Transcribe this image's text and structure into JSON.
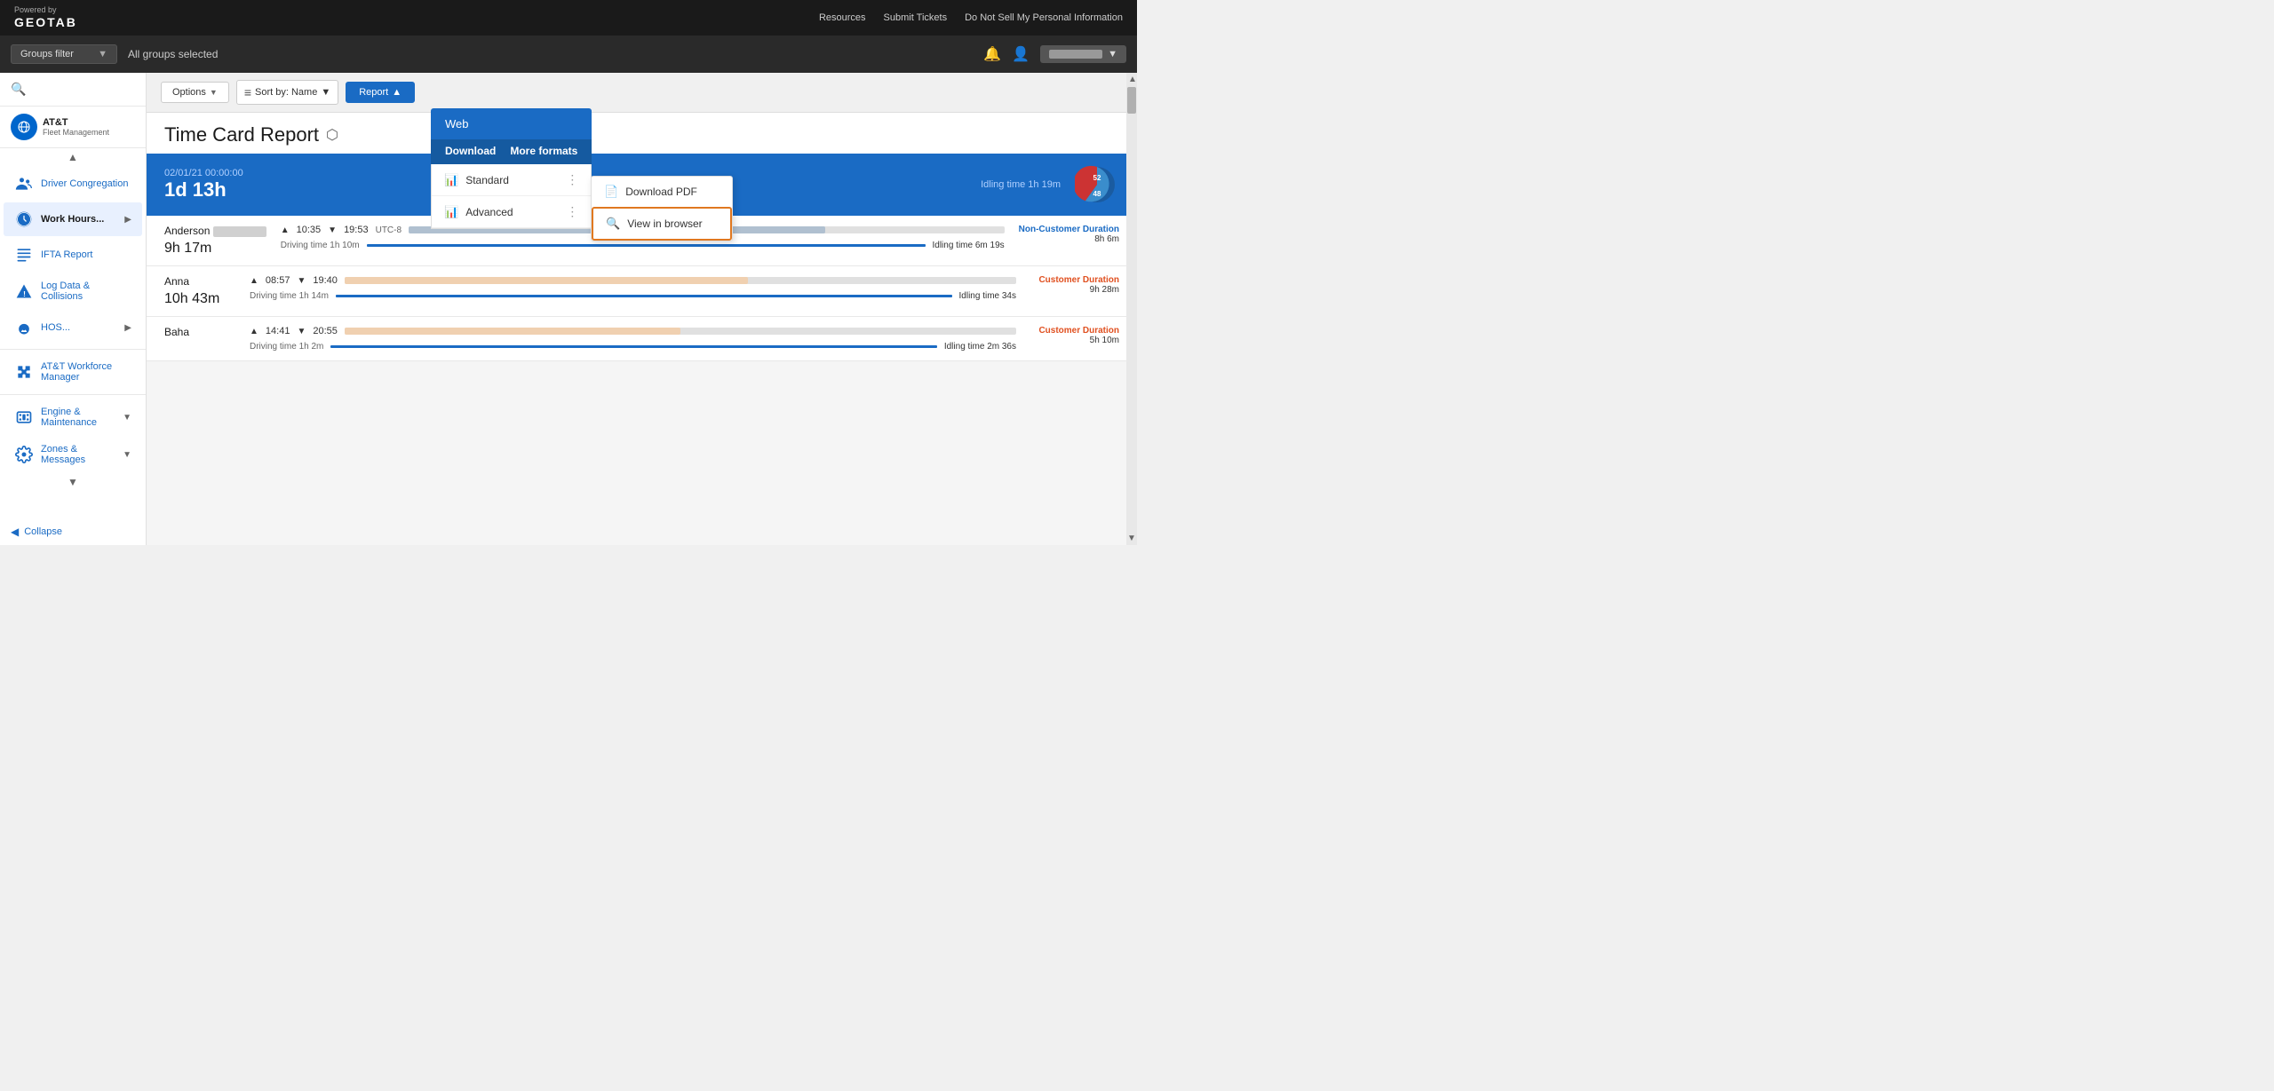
{
  "topnav": {
    "powered_by": "Powered by",
    "brand": "GEOTAB",
    "resources": "Resources",
    "submit_tickets": "Submit Tickets",
    "do_not_sell": "Do Not Sell My Personal Information"
  },
  "header": {
    "groups_filter_label": "Groups filter",
    "groups_filter_arrow": "▼",
    "all_groups_selected": "All groups selected",
    "bell_icon": "🔔",
    "user_icon": "👤",
    "user_name": ""
  },
  "sidebar": {
    "brand_name": "AT&T",
    "brand_sub": "Fleet Management",
    "items": [
      {
        "id": "driver-congregation",
        "label": "Driver Congregation",
        "icon": "people",
        "has_arrow": false
      },
      {
        "id": "work-hours",
        "label": "Work Hours...",
        "icon": "clock",
        "has_arrow": true
      },
      {
        "id": "ifta-report",
        "label": "IFTA Report",
        "icon": "list",
        "has_arrow": false
      },
      {
        "id": "log-data",
        "label": "Log Data & Collisions",
        "icon": "warning",
        "has_arrow": false
      },
      {
        "id": "hos",
        "label": "HOS...",
        "icon": "gauge",
        "has_arrow": true
      }
    ],
    "section2": [
      {
        "id": "att-workforce",
        "label": "AT&T Workforce Manager",
        "icon": "puzzle",
        "has_arrow": false
      }
    ],
    "section3": [
      {
        "id": "engine-maintenance",
        "label": "Engine & Maintenance",
        "icon": "film",
        "has_arrow": true
      },
      {
        "id": "zones-messages",
        "label": "Zones & Messages",
        "icon": "gear",
        "has_arrow": true
      }
    ],
    "collapse_label": "Collapse",
    "scroll_up": "▲",
    "scroll_down": "▼"
  },
  "toolbar": {
    "options_label": "Options",
    "sort_icon": "≡",
    "sort_label": "Sort by:  Name",
    "sort_arrow": "▼",
    "report_label": "Report",
    "report_arrow": "▲"
  },
  "report": {
    "title": "Time Card Report",
    "title_icon": "⬡",
    "summary_date": "02/01/21 00:00:00",
    "summary_total": "1d 13h",
    "idling_label": "Idling time 1h 19m",
    "pie_blue_pct": 52,
    "pie_red_pct": 48
  },
  "drivers": [
    {
      "name": "Anderson",
      "name_blurred": true,
      "total_time": "9h 17m",
      "schedule_start": "10:35",
      "schedule_end": "19:53",
      "timezone": "UTC-8",
      "driving_time": "Driving time 1h 10m",
      "idling_time": "Idling time 6m 19s",
      "duration_type": "Non-Customer Duration",
      "duration_value": "8h 6m",
      "duration_class": "non-customer"
    },
    {
      "name": "Anna",
      "name_blurred": false,
      "total_time": "10h 43m",
      "schedule_start": "08:57",
      "schedule_end": "19:40",
      "timezone": "",
      "driving_time": "Driving time 1h 14m",
      "idling_time": "Idling time 34s",
      "duration_type": "Customer Duration",
      "duration_value": "9h 28m",
      "duration_class": "customer"
    },
    {
      "name": "Baha",
      "name_blurred": false,
      "total_time": "",
      "schedule_start": "14:41",
      "schedule_end": "20:55",
      "timezone": "",
      "driving_time": "Driving time 1h 2m",
      "idling_time": "Idling time 2m 36s",
      "duration_type": "Customer Duration",
      "duration_value": "5h 10m",
      "duration_class": "customer"
    }
  ],
  "dropdown": {
    "web_label": "Web",
    "download_label": "Download",
    "more_formats_label": "More formats",
    "standard_label": "Standard",
    "advanced_label": "Advanced",
    "pdf_download_label": "Download PDF",
    "view_browser_label": "View in browser"
  },
  "scrollbar": {
    "up_arrow": "▲",
    "down_arrow": "▼"
  }
}
